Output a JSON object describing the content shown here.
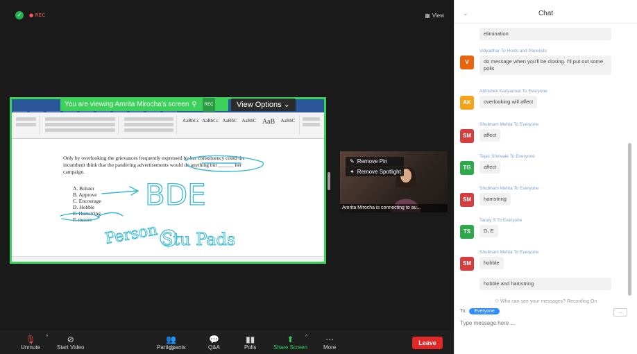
{
  "meeting": {
    "rec_label": "● REC",
    "view_label": "View"
  },
  "share": {
    "banner_text": "You are viewing Amrita Mirocha's screen",
    "rec_small": "REC",
    "view_options": "View Options ⌄"
  },
  "document": {
    "question": "Only by overlooking the grievances frequently expressed by her constituency could the incumbent think that the pandering advertisements would do anything but ______ her campaign.",
    "options": [
      "A. Bolster",
      "B. Approve",
      "C. Encourage",
      "D. Hobble",
      "E. Hamstring",
      "F. restore"
    ],
    "annotation_letters": "BDE",
    "annotation_words": [
      "Person",
      "Stu Pads"
    ]
  },
  "video": {
    "remove_pin": "Remove Pin",
    "remove_spotlight": "Remove Spotlight",
    "name_text": "Amrita Mirocha is connecting to au..."
  },
  "toolbar": {
    "unmute": "Unmute",
    "start_video": "Start Video",
    "participants": "Participants",
    "participants_count": "13",
    "qa": "Q&A",
    "polls": "Polls",
    "share_screen": "Share Screen",
    "more": "More",
    "leave": "Leave"
  },
  "chat": {
    "title": "Chat",
    "minimize": "⌄",
    "messages": [
      {
        "text": "elimination"
      },
      {
        "meta": "Vidyadhar To Hosts and Panelists",
        "initials": "V",
        "color": "#e8650e",
        "text": "do message when you'll be closing. I'll put out some polls"
      },
      {
        "meta": "Abhishek Kariyannar To Everyone",
        "initials": "AK",
        "color": "#f4a21b",
        "text": "overlooking will affect"
      },
      {
        "meta": "Shubham Mehta To Everyone",
        "initials": "SM",
        "color": "#d33e3e",
        "text": "affect"
      },
      {
        "meta": "Tejas Shinvale To Everyone",
        "initials": "TG",
        "color": "#2ea84b",
        "text": "affect"
      },
      {
        "meta": "Shubham Mehta To Everyone",
        "initials": "SM",
        "color": "#d33e3e",
        "text": "hamstring"
      },
      {
        "meta": "Tanay S To Everyone",
        "initials": "TS",
        "color": "#2ea84b",
        "text": "D, E"
      },
      {
        "meta": "Shubham Mehta To Everyone",
        "initials": "SM",
        "color": "#d33e3e",
        "text": "hobble"
      },
      {
        "text": "hobble and hamstring"
      }
    ],
    "notice": "Who can see your messages? Recording On",
    "to_label": "To:",
    "recipient": "Everyone",
    "input_placeholder": "Type message here ...",
    "more_label": "..."
  },
  "colors": {
    "share_border": "#3bd15a",
    "leave": "#e02828",
    "accent": "#2d8cff"
  }
}
